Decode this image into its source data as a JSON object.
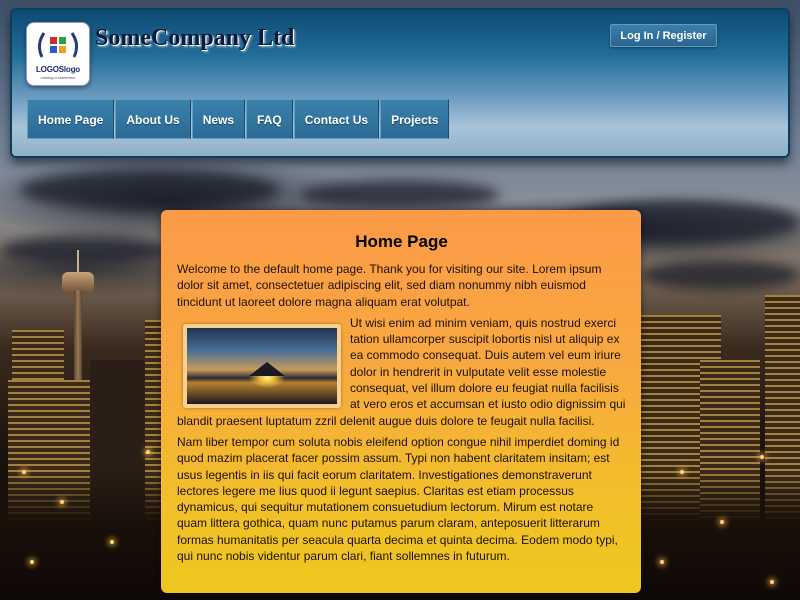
{
  "header": {
    "company_name": "SomeCompany Ltd",
    "login_label": "Log In / Register",
    "logo": {
      "text": "LOGOSlogo",
      "tagline": "making a statement"
    }
  },
  "nav": {
    "items": [
      {
        "label": "Home Page"
      },
      {
        "label": "About Us"
      },
      {
        "label": "News"
      },
      {
        "label": "FAQ"
      },
      {
        "label": "Contact Us"
      },
      {
        "label": "Projects"
      }
    ]
  },
  "content": {
    "title": "Home Page",
    "paragraphs": [
      "Welcome to the default home page. Thank you for visiting our site. Lorem ipsum dolor sit amet, consectetuer adipiscing elit, sed diam nonummy nibh euismod tincidunt ut laoreet dolore magna aliquam erat volutpat.",
      "Ut wisi enim ad minim veniam, quis nostrud exerci tation ullamcorper suscipit lobortis nisl ut aliquip ex ea commodo consequat. Duis autem vel eum iriure dolor in hendrerit in vulputate velit esse molestie consequat, vel illum dolore eu feugiat nulla facilisis at vero eros et accumsan et iusto odio dignissim qui blandit praesent luptatum zzril delenit augue duis dolore te feugait nulla facilisi.",
      "Nam liber tempor cum soluta nobis eleifend option congue nihil imperdiet doming id quod mazim placerat facer possim assum. Typi non habent claritatem insitam; est usus legentis in iis qui facit eorum claritatem. Investigationes demonstraverunt lectores legere me lius quod ii legunt saepius. Claritas est etiam processus dynamicus, qui sequitur mutationem consuetudium lectorum. Mirum est notare quam littera gothica, quam nunc putamus parum claram, anteposuerit litterarum formas humanitatis per seacula quarta decima et quinta decima. Eodem modo typi, qui nunc nobis videntur parum clari, fiant sollemnes in futurum."
    ]
  },
  "colors": {
    "header_blue": "#1f6c98",
    "nav_button": "#2b6a95",
    "content_orange": "#fd9a47",
    "content_yellow": "#eec71e"
  }
}
